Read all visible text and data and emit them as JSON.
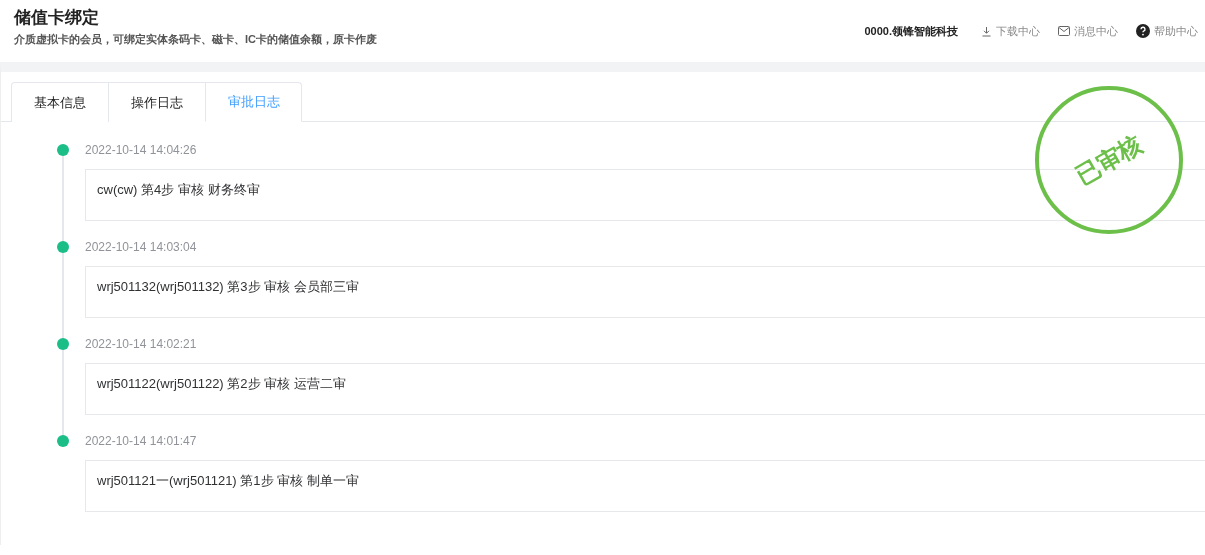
{
  "page": {
    "title": "储值卡绑定",
    "subtitle": "介质虚拟卡的会员，可绑定实体条码卡、磁卡、IC卡的储值余额，原卡作废"
  },
  "header": {
    "company": "0000.领锋智能科技",
    "links": [
      {
        "label": "下载中心",
        "kind": "download"
      },
      {
        "label": "消息中心",
        "kind": "mail"
      },
      {
        "label": "帮助中心",
        "kind": "help"
      }
    ]
  },
  "tabs": [
    {
      "label": "基本信息",
      "selected": false
    },
    {
      "label": "操作日志",
      "selected": false
    },
    {
      "label": "审批日志",
      "selected": true
    }
  ],
  "stamp": {
    "text": "已审核"
  },
  "timeline": [
    {
      "time": "2022-10-14 14:04:26",
      "text": "cw(cw) 第4步 审核 财务终审"
    },
    {
      "time": "2022-10-14 14:03:04",
      "text": "wrj501132(wrj501132) 第3步 审核 会员部三审"
    },
    {
      "time": "2022-10-14 14:02:21",
      "text": "wrj501122(wrj501122) 第2步 审核 运营二审"
    },
    {
      "time": "2022-10-14 14:01:47",
      "text": "wrj501121一(wrj501121) 第1步 审核 制单一审"
    }
  ]
}
